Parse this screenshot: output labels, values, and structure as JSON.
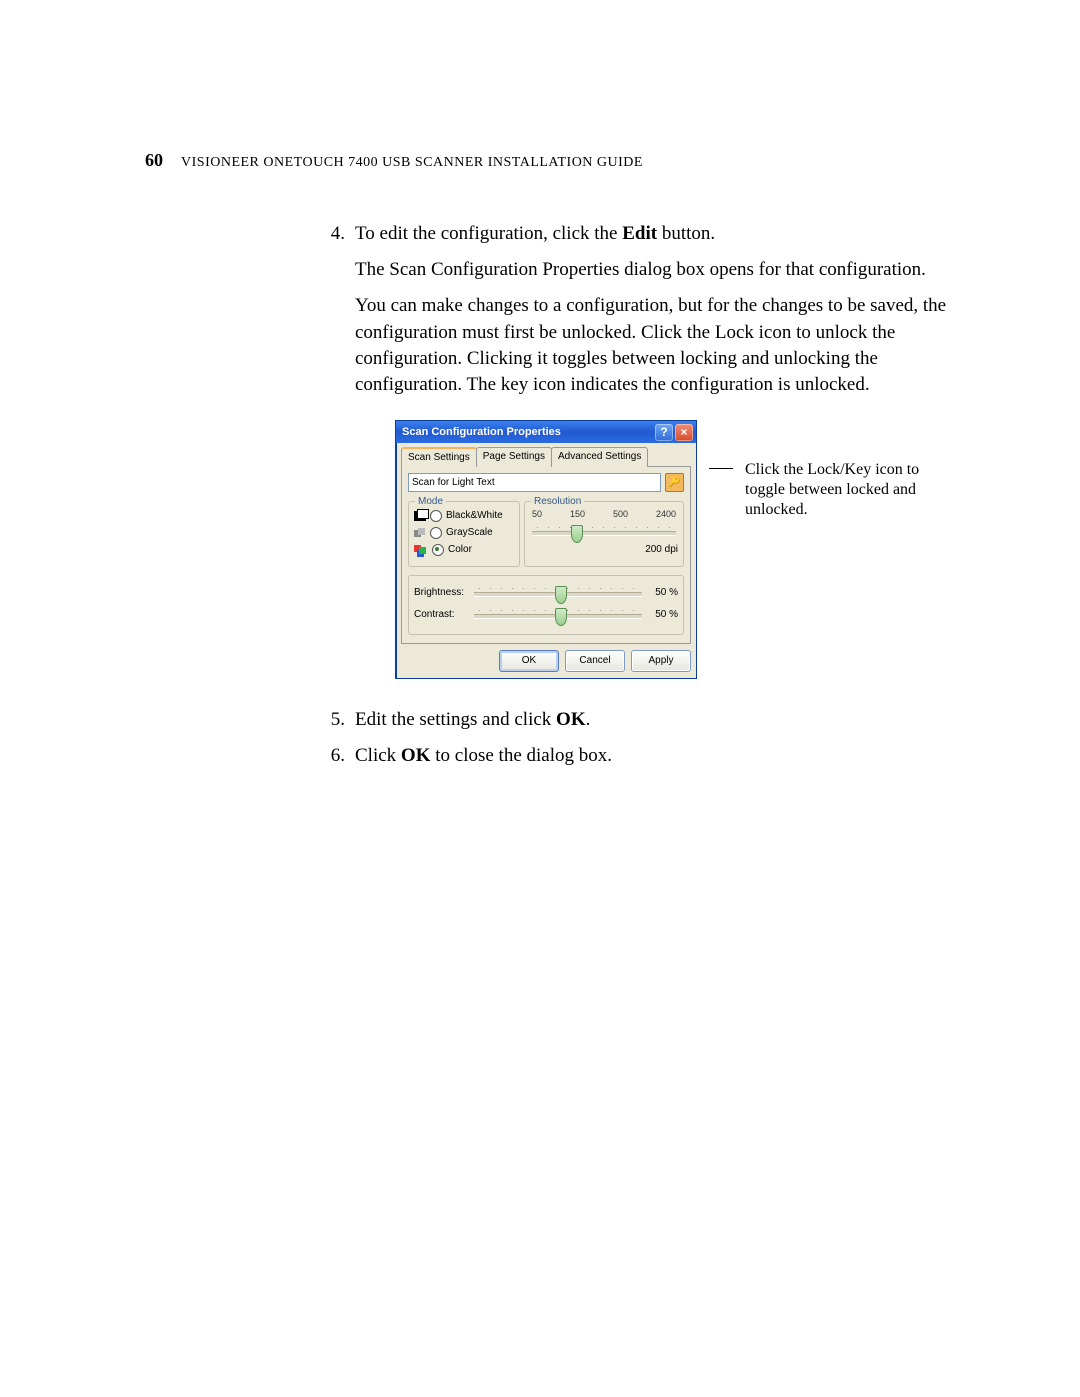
{
  "header": {
    "page_number": "60",
    "text_pre": "V",
    "text": "ISIONEER ONETOUCH 7400 USB SCANNER INSTALLATION GUIDE"
  },
  "steps": {
    "s4": {
      "num": "4.",
      "line1_pre": "To edit the configuration, click the ",
      "line1_bold": "Edit",
      "line1_post": " button.",
      "para2": "The Scan Configuration Properties dialog box opens for that configuration.",
      "para3": "You can make changes to a configuration, but for the changes to be saved, the configuration must first be unlocked. Click the Lock icon to unlock the configuration. Clicking it toggles between locking and unlocking the configuration. The key icon indicates the configuration is unlocked."
    },
    "s5": {
      "num": "5.",
      "pre": "Edit the settings and click ",
      "bold": "OK",
      "post": "."
    },
    "s6": {
      "num": "6.",
      "pre": "Click ",
      "bold": "OK",
      "post": " to close the dialog box."
    }
  },
  "callout": "Click the Lock/Key icon to toggle between locked and unlocked.",
  "dialog": {
    "title": "Scan Configuration Properties",
    "tabs": [
      "Scan Settings",
      "Page Settings",
      "Advanced Settings"
    ],
    "config_name": "Scan for Light Text",
    "mode": {
      "legend": "Mode",
      "options": [
        "Black&White",
        "GrayScale",
        "Color"
      ],
      "selected": "Color"
    },
    "resolution": {
      "legend": "Resolution",
      "ticks": [
        "50",
        "150",
        "500",
        "2400"
      ],
      "value": "200 dpi"
    },
    "brightness": {
      "label": "Brightness:",
      "value": "50 %"
    },
    "contrast": {
      "label": "Contrast:",
      "value": "50 %"
    },
    "buttons": {
      "ok": "OK",
      "cancel": "Cancel",
      "apply": "Apply"
    }
  }
}
